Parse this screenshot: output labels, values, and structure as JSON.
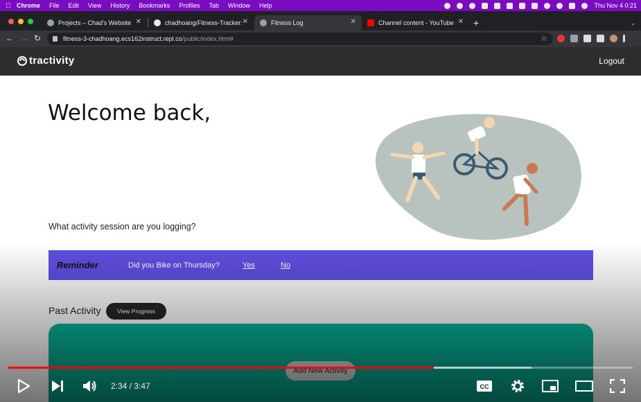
{
  "menubar": {
    "items": [
      "Chrome",
      "File",
      "Edit",
      "View",
      "History",
      "Bookmarks",
      "Profiles",
      "Tab",
      "Window",
      "Help"
    ],
    "clock": "Thu Nov 4  0:21"
  },
  "tabs": [
    {
      "title": "Projects – Chad's Website",
      "active": false
    },
    {
      "title": "chadhoang/Fitness-Tracker: W",
      "active": false
    },
    {
      "title": "Fitness Log",
      "active": true
    },
    {
      "title": "Channel content - YouTube Stu",
      "active": false
    }
  ],
  "address": {
    "host": "fitness-3-chadhoang.ecs162instruct.repl.co",
    "path": "/public/index.html#"
  },
  "site": {
    "logo_text": "tractivity",
    "logout_label": "Logout"
  },
  "main": {
    "welcome": "Welcome back,",
    "question": "What activity session are you logging?",
    "reminder": {
      "label": "Reminder",
      "question": "Did you Bike on Thursday?",
      "yes": "Yes",
      "no": "No"
    },
    "past_activity": "Past Activity",
    "view_progress": "View Progress",
    "add_activity": "Add New Activity"
  },
  "video": {
    "timecode": "2:34 / 3:47",
    "played_fraction": 0.682,
    "buffered_fraction": 0.838
  },
  "colors": {
    "menubar": "#7a0bc0",
    "header": "#2d2d2d",
    "reminder": "#5f4fe0",
    "card": "#07b59a",
    "progress": "#ff0000"
  }
}
